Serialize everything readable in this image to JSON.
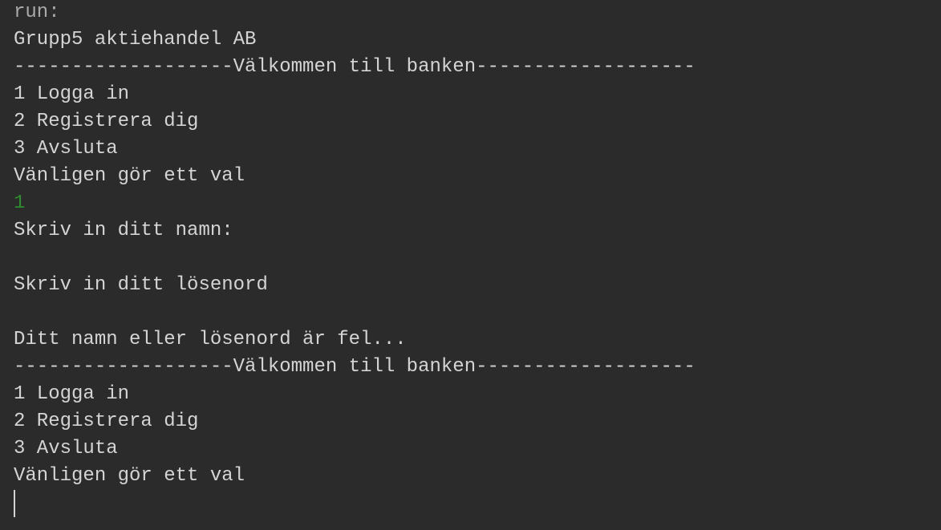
{
  "console": {
    "lines": [
      {
        "text": "run:",
        "kind": "system"
      },
      {
        "text": "Grupp5 aktiehandel AB",
        "kind": "output"
      },
      {
        "text": "-------------------Välkommen till banken-------------------",
        "kind": "output"
      },
      {
        "text": "1 Logga in",
        "kind": "output"
      },
      {
        "text": "2 Registrera dig",
        "kind": "output"
      },
      {
        "text": "3 Avsluta",
        "kind": "output"
      },
      {
        "text": "Vänligen gör ett val",
        "kind": "output"
      },
      {
        "text": "1",
        "kind": "input"
      },
      {
        "text": "Skriv in ditt namn:",
        "kind": "output"
      },
      {
        "text": "",
        "kind": "output"
      },
      {
        "text": "Skriv in ditt lösenord",
        "kind": "output"
      },
      {
        "text": "",
        "kind": "output"
      },
      {
        "text": "Ditt namn eller lösenord är fel...",
        "kind": "output"
      },
      {
        "text": "-------------------Välkommen till banken-------------------",
        "kind": "output"
      },
      {
        "text": "1 Logga in",
        "kind": "output"
      },
      {
        "text": "2 Registrera dig",
        "kind": "output"
      },
      {
        "text": "3 Avsluta",
        "kind": "output"
      },
      {
        "text": "Vänligen gör ett val",
        "kind": "output"
      }
    ]
  },
  "colors": {
    "background": "#2b2b2b",
    "text": "#d4d4d4",
    "system_text": "#a9a9a9",
    "input_text": "#2e8b2e"
  }
}
